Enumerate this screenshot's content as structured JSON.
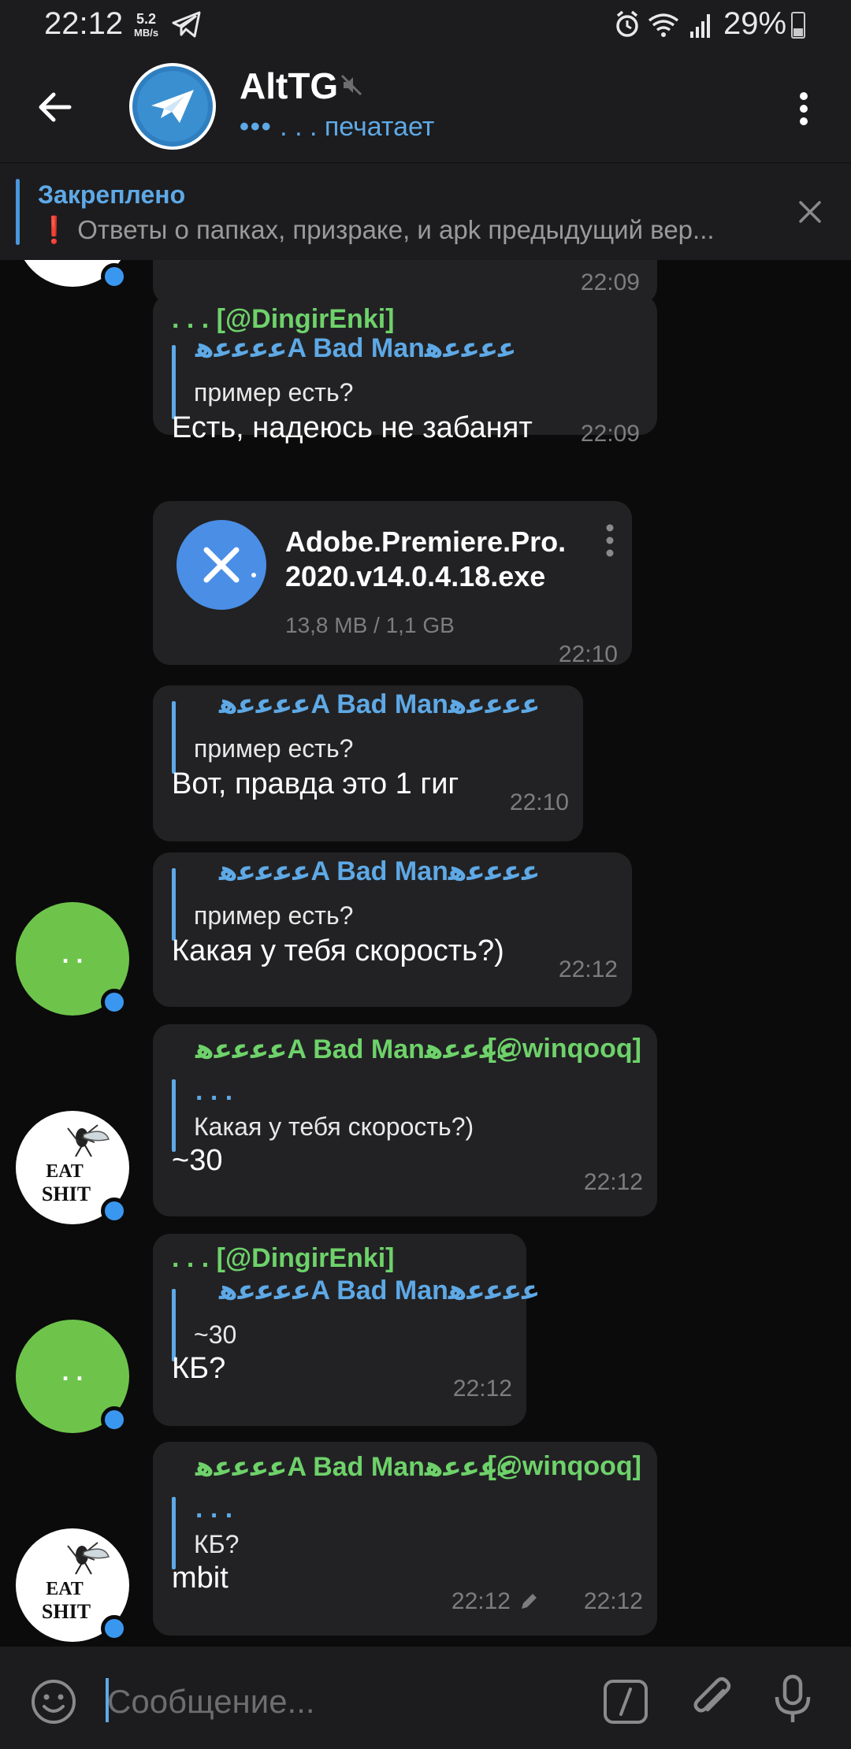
{
  "status_bar": {
    "time": "22:12",
    "speed_value": "5.2",
    "speed_unit": "MB/s",
    "battery": "29%"
  },
  "header": {
    "title": "AltTG",
    "status_dots": "•••",
    "status_text": ". . . печатает"
  },
  "pinned": {
    "title": "Закреплено",
    "excl": "❗",
    "text": "Ответы о папках, призраке, и apk предыдущий вер..."
  },
  "messages": {
    "top_partial_time": "22:09",
    "m1": {
      "sender": ". . . [@DingirEnki]",
      "reply_name": "ﻋﻋﻋﻋﻫA Bad Manﻋﻋﻋﻋﻫ",
      "reply_text": "пример есть?",
      "text": "Есть, надеюсь не забанят",
      "time": "22:09"
    },
    "m2": {
      "file_name_1": "Adobe.Premiere.Pro.",
      "file_name_2": "2020.v14.0.4.18.exe",
      "file_size": "13,8 MB / 1,1 GB",
      "time": "22:10"
    },
    "m3": {
      "reply_name": "ﻋﻋﻋﻋﻫA Bad Manﻋﻋﻋﻋﻫ",
      "reply_text": "пример есть?",
      "text": "Вот, правда это 1 гиг",
      "time": "22:10"
    },
    "m4": {
      "reply_name": "ﻋﻋﻋﻋﻫA Bad Manﻋﻋﻋﻋﻫ",
      "reply_text": "пример есть?",
      "text": "Какая у тебя скорость?)",
      "time": "22:12",
      "avatar_text": ". ."
    },
    "m5": {
      "sender": "ﻋﻋﻋﻋﻫA Bad Manﻋﻋﻋﻋﻫ",
      "handle": "[@winqooq]",
      "reply_name": ". . .",
      "reply_text": "Какая у тебя скорость?)",
      "text": "~30",
      "time": "22:12"
    },
    "m6": {
      "sender": ". . . [@DingirEnki]",
      "reply_name": "ﻋﻋﻋﻋﻫA Bad Manﻋﻋﻋﻋﻫ",
      "reply_text": "~30",
      "text": "КБ?",
      "time": "22:12",
      "avatar_text": ". ."
    },
    "m7": {
      "sender": "ﻋﻋﻋﻋﻫA Bad Manﻋﻋﻋﻋﻫ",
      "handle": "[@winqooq]",
      "reply_name": ". . .",
      "reply_text": "КБ?",
      "text": "mbit",
      "time": "22:12",
      "edited_time": "22:12"
    }
  },
  "input": {
    "placeholder": "Сообщение..."
  },
  "colors": {
    "accent_blue": "#5ea9e6",
    "sender_green": "#6ed26a",
    "bubble": "#222224",
    "online_dot": "#3a97f0",
    "avatar_green": "#6ec44b"
  },
  "icons": [
    "back-arrow-icon",
    "mute-icon",
    "more-vert-icon",
    "close-icon",
    "cancel-download-icon",
    "emoji-icon",
    "bot-command-icon",
    "attach-icon",
    "mic-icon",
    "telegram-icon",
    "alarm-icon",
    "wifi-icon",
    "signal-icon",
    "battery-icon",
    "pencil-icon"
  ]
}
